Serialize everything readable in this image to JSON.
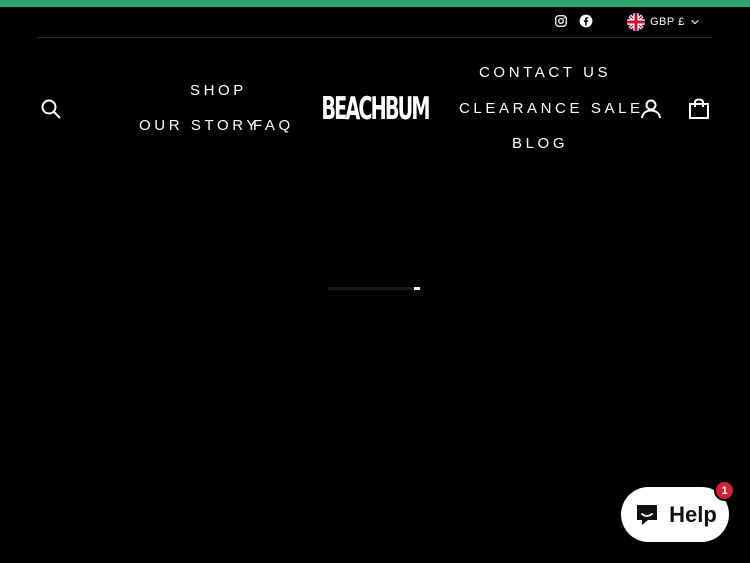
{
  "colors": {
    "background": "#000000",
    "announcement_bar": "#2ea66a",
    "text": "#ffffff",
    "badge": "#d1213a"
  },
  "utility_bar": {
    "social": [
      {
        "label": "Instagram",
        "icon": "instagram-icon"
      },
      {
        "label": "Facebook",
        "icon": "facebook-icon"
      }
    ],
    "currency": {
      "flag": "uk-flag-icon",
      "label": "GBP £",
      "icon": "chevron-down-icon"
    }
  },
  "header": {
    "search_icon": "search-icon",
    "nav_left": [
      "SHOP",
      "OUR STORY",
      "FAQ"
    ],
    "logo": "BEACHBUM",
    "nav_right": [
      "CONTACT US",
      "CLEARANCE SALE",
      "BLOG"
    ],
    "login_icon": "user-icon",
    "cart_icon": "bag-icon"
  },
  "loader": {
    "progress": 0.06
  },
  "chat": {
    "label": "Help",
    "icon": "chat-icon",
    "badge_count": "1"
  }
}
